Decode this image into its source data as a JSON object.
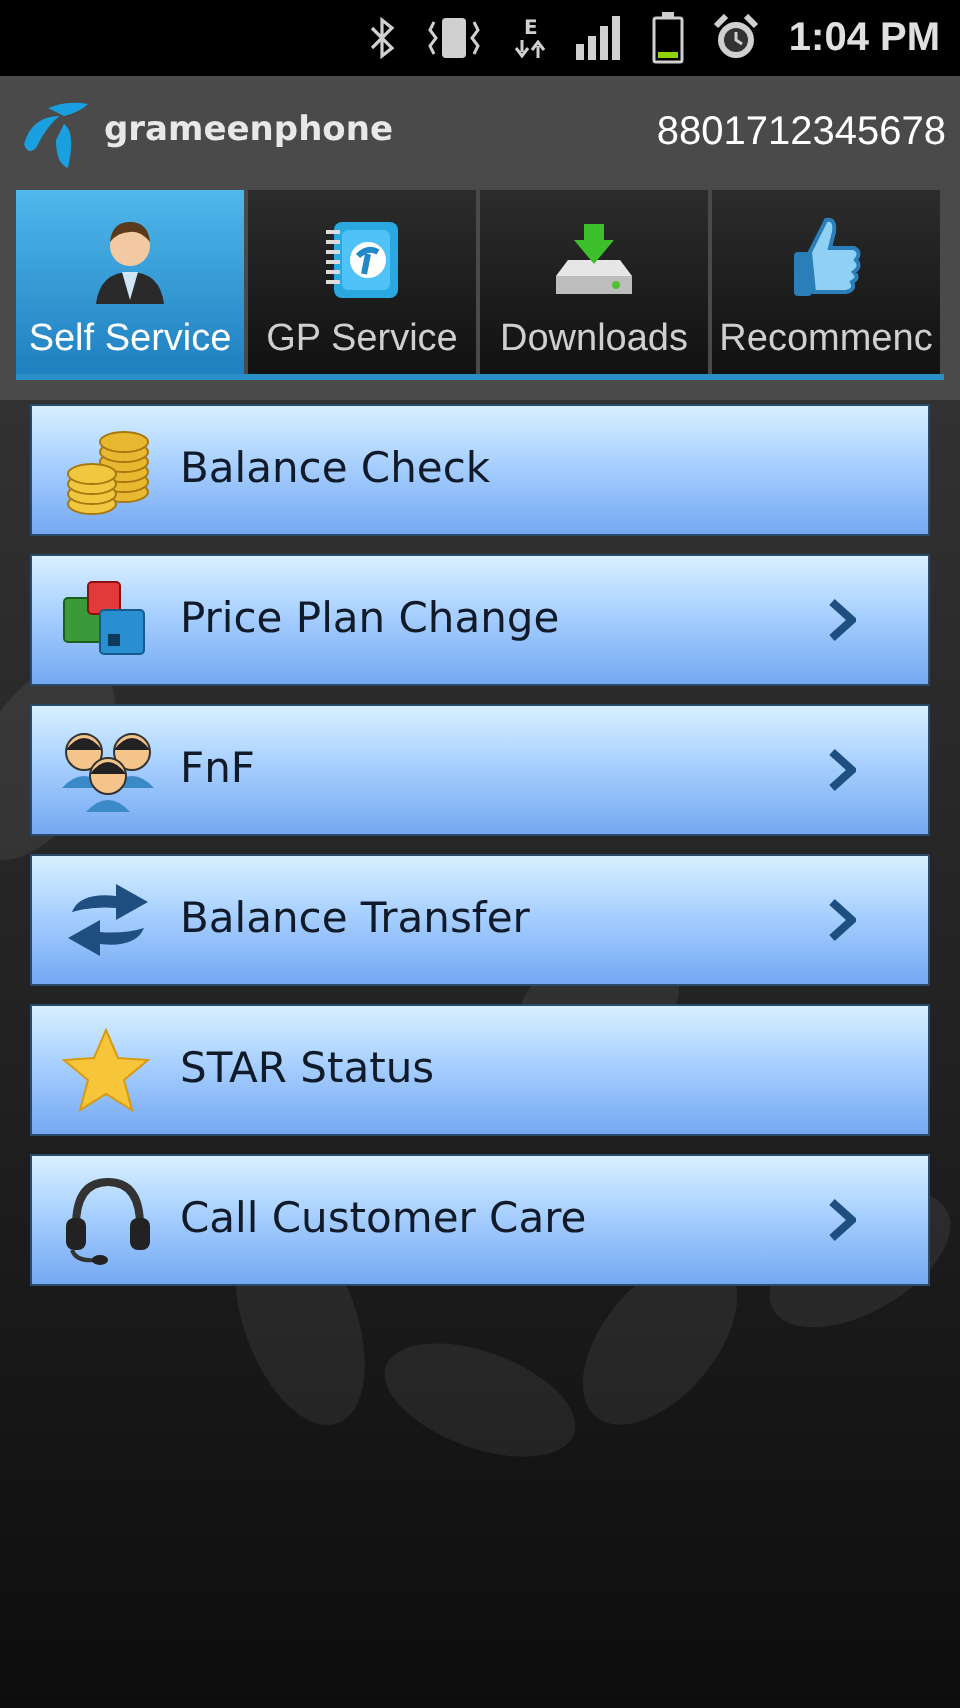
{
  "status_bar": {
    "network_type": "E",
    "time": "1:04 PM"
  },
  "header": {
    "brand": "grameenphone",
    "phone_number": "8801712345678"
  },
  "tabs": [
    {
      "label": "Self Service",
      "selected": true
    },
    {
      "label": "GP Service",
      "selected": false
    },
    {
      "label": "Downloads",
      "selected": false
    },
    {
      "label": "Recommenc",
      "selected": false
    }
  ],
  "menu_items": [
    {
      "label": "Balance Check",
      "has_arrow": false
    },
    {
      "label": "Price Plan Change",
      "has_arrow": true
    },
    {
      "label": "FnF",
      "has_arrow": true
    },
    {
      "label": "Balance Transfer",
      "has_arrow": true
    },
    {
      "label": "STAR Status",
      "has_arrow": false
    },
    {
      "label": "Call Customer Care",
      "has_arrow": true
    }
  ]
}
